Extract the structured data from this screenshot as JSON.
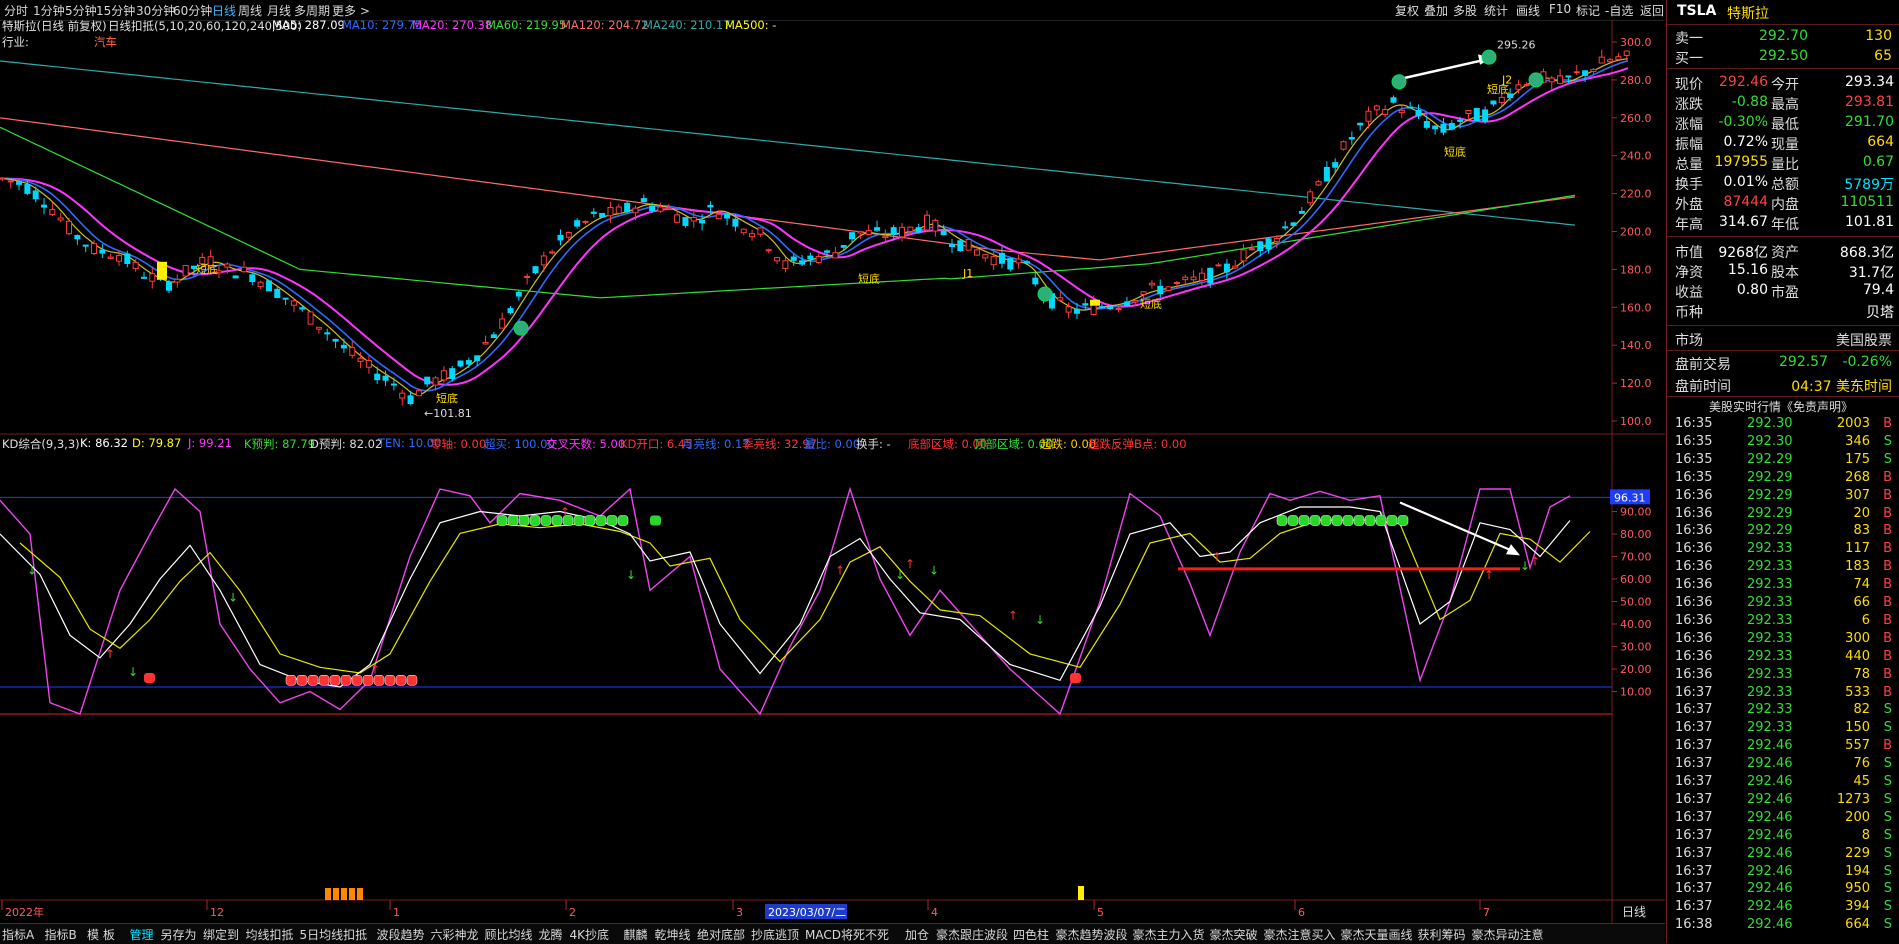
{
  "toolbar": {
    "periods": [
      "分时",
      "1分钟",
      "5分钟",
      "15分钟",
      "30分钟",
      "60分钟",
      "日线",
      "周线",
      "月线",
      "多周期",
      "更多 >"
    ],
    "active": "日线",
    "right": [
      "复权",
      "叠加",
      "多股",
      "统计",
      "画线",
      "F10",
      "标记",
      "-自选",
      "返回"
    ]
  },
  "main": {
    "title": "特斯拉(日线 前复权)",
    "overlay_label": "日线扣抵(5,10,20,60,120,240,500)",
    "ma": [
      {
        "label": "MA5: 287.09",
        "color": "#ffffff"
      },
      {
        "label": "MA10: 279.75",
        "color": "#2b6bff"
      },
      {
        "label": "MA20: 270.38",
        "color": "#ff33ff"
      },
      {
        "label": "MA60: 219.95",
        "color": "#33dd33"
      },
      {
        "label": "MA120: 204.72",
        "color": "#ff6a6a"
      },
      {
        "label": "MA240: 210.17",
        "color": "#2fa8a8"
      },
      {
        "label": "MA500: -",
        "color": "#ffff00"
      }
    ],
    "industry_label": "行业:",
    "industry_value": "汽车",
    "y_ticks": [
      "300.0",
      "280.0",
      "260.0",
      "240.0",
      "220.0",
      "200.0",
      "180.0",
      "160.0",
      "140.0",
      "120.0",
      "100.0"
    ],
    "high_label": "295.26",
    "low_label": "101.81",
    "signals": [
      "短底",
      "短底",
      "短底",
      "短底",
      "短底",
      "J1",
      "短底",
      "J2"
    ]
  },
  "kd": {
    "title": "KD综合(9,3,3)",
    "values": [
      {
        "label": "K: 86.32",
        "color": "#ffffff"
      },
      {
        "label": "D: 79.87",
        "color": "#ffff00"
      },
      {
        "label": "J: 99.21",
        "color": "#ff33ff"
      },
      {
        "label": "K预判: 87.79",
        "color": "#33dd33"
      },
      {
        "label": "D预判: 82.02",
        "color": "#dddddd"
      },
      {
        "label": "TEN: 10.00",
        "color": "#2b6bff"
      },
      {
        "label": "零轴: 0.00",
        "color": "#ff3333"
      },
      {
        "label": "超买: 100.00",
        "color": "#2b6bff"
      },
      {
        "label": "交叉天数: 5.00",
        "color": "#ff33ff"
      },
      {
        "label": "KD开口: 6.45",
        "color": "#ff3333"
      },
      {
        "label": "月亮线: 0.17",
        "color": "#2b6bff"
      },
      {
        "label": "季亮线: 32.97",
        "color": "#ff3333"
      },
      {
        "label": "量比: 0.00",
        "color": "#2b6bff"
      },
      {
        "label": "换手: -",
        "color": "#dddddd"
      },
      {
        "label": "底部区域: 0.00",
        "color": "#ff3333"
      },
      {
        "label": "顶部区域: 0.00",
        "color": "#33dd33"
      },
      {
        "label": "超跌: 0.00",
        "color": "#ffcc00"
      },
      {
        "label": "超跌反弹B点: 0.00",
        "color": "#ff3333"
      }
    ],
    "y_ticks": [
      "90.00",
      "80.00",
      "70.00",
      "60.00",
      "50.00",
      "40.00",
      "30.00",
      "20.00",
      "10.00"
    ],
    "current_tag": "96.31",
    "daily_tag": "日线"
  },
  "x_axis": {
    "labels": [
      "2022年",
      "12",
      "1",
      "2",
      "3",
      "4",
      "5",
      "6",
      "7"
    ],
    "cursor_date": "2023/03/07/二"
  },
  "bottom_tabs": [
    "指标A",
    "指标B",
    "模 板",
    "管理",
    "另存为",
    "绑定到",
    "均线扣抵",
    "5日均线扣抵",
    "波段趋势",
    "六彩神龙",
    "顾比均线",
    "龙腾",
    "4K抄底",
    "麒麟",
    "乾坤线",
    "绝对底部",
    "抄底逃顶",
    "MACD将死不死",
    "加仓",
    "豪杰跟庄波段",
    "四色柱",
    "豪杰趋势波段",
    "豪杰主力入货",
    "豪杰突破",
    "豪杰注意买入",
    "豪杰天量画线",
    "获利筹码",
    "豪杰异动注意"
  ],
  "bottom_active": "管理",
  "panel": {
    "symbol": "TSLA",
    "name": "特斯拉",
    "sell1": {
      "label": "卖一",
      "price": "292.70",
      "vol": "130"
    },
    "buy1": {
      "label": "买一",
      "price": "292.50",
      "vol": "65"
    },
    "quote_rows": [
      [
        "现价",
        "292.46",
        "#ff4040",
        "今开",
        "293.34",
        "#ffffff"
      ],
      [
        "涨跌",
        "-0.88",
        "#33dd33",
        "最高",
        "293.81",
        "#ff4040"
      ],
      [
        "涨幅",
        "-0.30%",
        "#33dd33",
        "最低",
        "291.70",
        "#33dd33"
      ],
      [
        "振幅",
        "0.72%",
        "#ffffff",
        "现量",
        "664",
        "#ffdd00"
      ],
      [
        "总量",
        "197955",
        "#ffdd00",
        "量比",
        "0.67",
        "#33dd33"
      ],
      [
        "换手",
        "0.01%",
        "#ffffff",
        "总额",
        "5789万",
        "#00e0ff"
      ],
      [
        "外盘",
        "87444",
        "#ff4040",
        "内盘",
        "110511",
        "#33dd33"
      ],
      [
        "年高",
        "314.67",
        "#ffffff",
        "年低",
        "101.81",
        "#ffffff"
      ]
    ],
    "fund_rows": [
      [
        "市值",
        "9268亿",
        "资产",
        "868.3亿"
      ],
      [
        "净资",
        "15.16",
        "股本",
        "31.7亿"
      ],
      [
        "收益",
        "0.80",
        "市盈",
        "79.4"
      ],
      [
        "币种",
        "",
        "",
        "贝塔"
      ]
    ],
    "market_label": "市场",
    "market_value": "美国股票",
    "pre_trade_label": "盘前交易",
    "pre_trade_price": "292.57",
    "pre_trade_pct": "-0.26%",
    "pre_time_label": "盘前时间",
    "pre_time_value": "04:37 美东时间",
    "realtime_title": "美股实时行情《免责声明》",
    "ticks": [
      [
        "16:35",
        "292.30",
        "2003",
        "B"
      ],
      [
        "16:35",
        "292.30",
        "346",
        "S"
      ],
      [
        "16:35",
        "292.29",
        "175",
        "S"
      ],
      [
        "16:35",
        "292.29",
        "268",
        "B"
      ],
      [
        "16:36",
        "292.29",
        "307",
        "B"
      ],
      [
        "16:36",
        "292.29",
        "20",
        "B"
      ],
      [
        "16:36",
        "292.29",
        "83",
        "B"
      ],
      [
        "16:36",
        "292.33",
        "117",
        "B"
      ],
      [
        "16:36",
        "292.33",
        "183",
        "B"
      ],
      [
        "16:36",
        "292.33",
        "74",
        "B"
      ],
      [
        "16:36",
        "292.33",
        "66",
        "B"
      ],
      [
        "16:36",
        "292.33",
        "6",
        "B"
      ],
      [
        "16:36",
        "292.33",
        "300",
        "B"
      ],
      [
        "16:36",
        "292.33",
        "440",
        "B"
      ],
      [
        "16:36",
        "292.33",
        "78",
        "B"
      ],
      [
        "16:37",
        "292.33",
        "533",
        "B"
      ],
      [
        "16:37",
        "292.33",
        "82",
        "S"
      ],
      [
        "16:37",
        "292.33",
        "150",
        "S"
      ],
      [
        "16:37",
        "292.46",
        "557",
        "B"
      ],
      [
        "16:37",
        "292.46",
        "76",
        "S"
      ],
      [
        "16:37",
        "292.46",
        "45",
        "S"
      ],
      [
        "16:37",
        "292.46",
        "1273",
        "S"
      ],
      [
        "16:37",
        "292.46",
        "200",
        "S"
      ],
      [
        "16:37",
        "292.46",
        "8",
        "S"
      ],
      [
        "16:37",
        "292.46",
        "229",
        "S"
      ],
      [
        "16:37",
        "292.46",
        "194",
        "S"
      ],
      [
        "16:37",
        "292.46",
        "950",
        "S"
      ],
      [
        "16:37",
        "292.46",
        "394",
        "S"
      ],
      [
        "16:38",
        "292.46",
        "664",
        "S"
      ]
    ]
  }
}
